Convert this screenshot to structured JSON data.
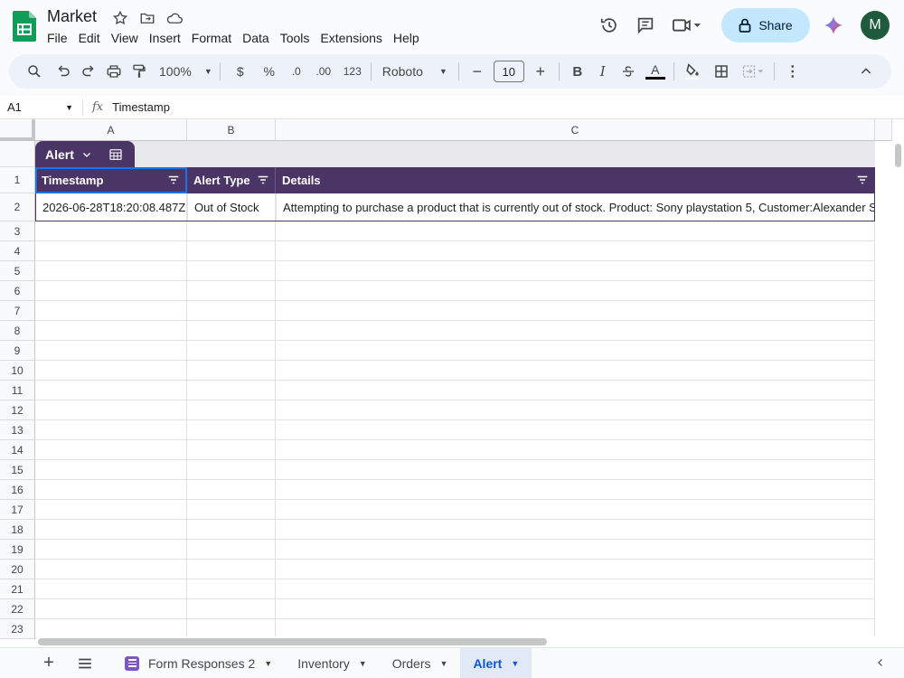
{
  "app": {
    "title": "Market",
    "menu": [
      "File",
      "Edit",
      "View",
      "Insert",
      "Format",
      "Data",
      "Tools",
      "Extensions",
      "Help"
    ],
    "share_label": "Share",
    "avatar_letter": "M"
  },
  "toolbar": {
    "zoom": "100%",
    "currency": "$",
    "percent": "%",
    "decrease_decimal": ".0",
    "increase_decimal": ".00",
    "number_format": "123",
    "font": "Roboto",
    "font_size": "10",
    "bold": "B",
    "italic": "I",
    "text_color": "A"
  },
  "formula_bar": {
    "cell_ref": "A1",
    "fx": "fx",
    "content": "Timestamp"
  },
  "grid": {
    "columns": [
      "A",
      "B",
      "C"
    ],
    "rows": [
      "1",
      "2",
      "3",
      "4",
      "5",
      "6",
      "7",
      "8",
      "9",
      "10",
      "11",
      "12",
      "13",
      "14",
      "15",
      "16",
      "17",
      "18",
      "19",
      "20",
      "21",
      "22",
      "23"
    ],
    "table_name": "Alert",
    "headers": [
      "Timestamp",
      "Alert Type",
      "Details"
    ],
    "data": [
      [
        "2026-06-28T18:20:08.487Z",
        "Out of Stock",
        "Attempting to purchase a product that is currently out of stock. Product: Sony playstation 5, Customer:Alexander Sm"
      ]
    ]
  },
  "sheets": {
    "tabs": [
      {
        "label": "Form Responses 2"
      },
      {
        "label": "Inventory"
      },
      {
        "label": "Orders"
      },
      {
        "label": "Alert"
      }
    ]
  },
  "colors": {
    "table_header": "#4a3566",
    "share_bg": "#c2e7ff",
    "active_tab": "#0b57d0"
  }
}
